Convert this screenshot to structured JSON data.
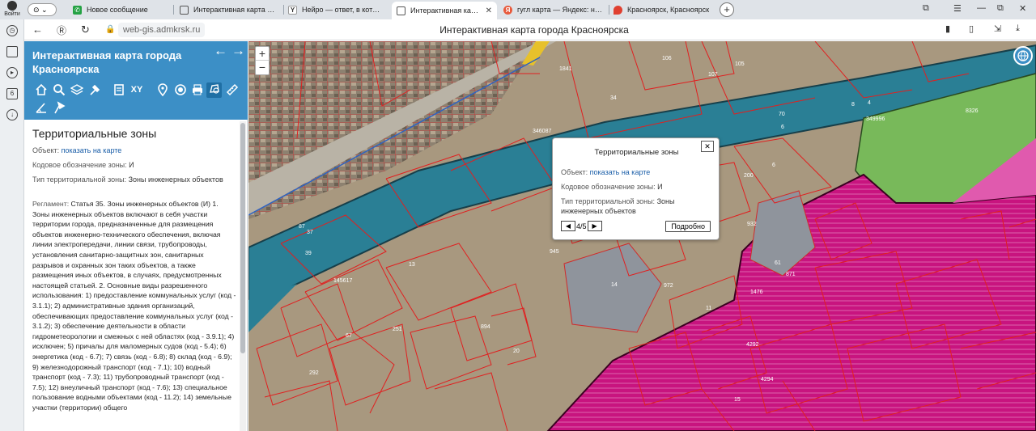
{
  "browser": {
    "login_label": "Войти",
    "tabs": [
      {
        "label": "Новое сообщение",
        "icon": "whatsapp-icon",
        "color": "#25a244"
      },
      {
        "label": "Интерактивная карта гор",
        "icon": "document-icon",
        "color": "#555555"
      },
      {
        "label": "Нейро — ответ, в которое",
        "icon": "yandex-icon",
        "color": "#333333"
      },
      {
        "label": "Интерактивная карта г",
        "icon": "document-icon",
        "color": "#555555",
        "active": true
      },
      {
        "label": "гугл карта — Яндекс: нашл",
        "icon": "yandex-search-icon",
        "color": "#e85a3c"
      },
      {
        "label": "Красноярск, Красноярск",
        "icon": "map-pin-icon",
        "color": "#e04030"
      }
    ],
    "url": "web-gis.admkrsk.ru",
    "page_title": "Интерактивная карта города Красноярска"
  },
  "app": {
    "title": "Интерактивная карта города Красноярска",
    "tools": [
      "home-icon",
      "search-icon",
      "layers-icon",
      "hammer-icon",
      "document-icon",
      "xy-label",
      "pin-icon",
      "target-icon",
      "print-icon",
      "measure-area-icon",
      "ruler-icon",
      "angle-icon",
      "flag-icon"
    ],
    "xy_label": "XY"
  },
  "info": {
    "zone_title": "Территориальные зоны",
    "object_label": "Объект:",
    "object_link": "показать на карте",
    "code_label": "Кодовое обозначение зоны:",
    "code_value": "И",
    "type_label": "Тип территориальной зоны:",
    "type_value": "Зоны инженерных объектов",
    "reglament_label": "Регламент:",
    "reglament_text": "Статья 35. Зоны инженерных объектов (И) 1. Зоны инженерных объектов включают в себя участки территории города, предназначенные для размещения объектов инженерно-технического обеспечения, включая линии электропередачи, линии связи, трубопроводы, установления санитарно-защитных зон, санитарных разрывов и охранных зон таких объектов, а также размещения иных объектов, в случаях, предусмотренных настоящей статьей. 2. Основные виды разрешенного использования: 1) предоставление коммунальных услуг (код - 3.1.1); 2) административные здания организаций, обеспечивающих предоставление коммунальных услуг (код - 3.1.2); 3) обеспечение деятельности в области гидрометеорологии и смежных с ней областях (код - 3.9.1); 4) исключен; 5) причалы для маломерных судов (код - 5.4); 6) энергетика (код - 6.7); 7) связь (код - 6.8); 8) склад (код - 6.9); 9) железнодорожный транспорт (код - 7.1); 10) водный транспорт (код - 7.3); 11) трубопроводный транспорт (код - 7.5); 12) внеуличный транспорт (код - 7.6); 13) специальное пользование водными объектами (код - 11.2); 14) земельные участки (территории) общего"
  },
  "popup": {
    "title": "Территориальные зоны",
    "object_label": "Объект:",
    "object_link": "показать на карте",
    "code_label": "Кодовое обозначение зоны:",
    "code_value": "И",
    "type_label": "Тип территориальной зоны:",
    "type_value": "Зоны инженерных объектов",
    "pager": "4/5",
    "more_label": "Подробно"
  },
  "map": {
    "zoom_in": "+",
    "zoom_out": "−",
    "parcel_labels": [
      "34",
      "70",
      "6",
      "8",
      "4",
      "106",
      "107",
      "105",
      "1841",
      "346087",
      "349996",
      "8326",
      "200",
      "6",
      "61",
      "932",
      "472",
      "1476",
      "4292",
      "4294",
      "871",
      "11",
      "14",
      "20",
      "894",
      "945",
      "972",
      "37",
      "39",
      "87",
      "67",
      "251",
      "292",
      "145617",
      "13",
      "15"
    ]
  },
  "colors": {
    "header_blue": "#3c8fc6",
    "river": "#2a7f95",
    "engineering_zone": "#c8147f",
    "green_zone": "#78b95a",
    "parcel_line": "#e02020"
  }
}
